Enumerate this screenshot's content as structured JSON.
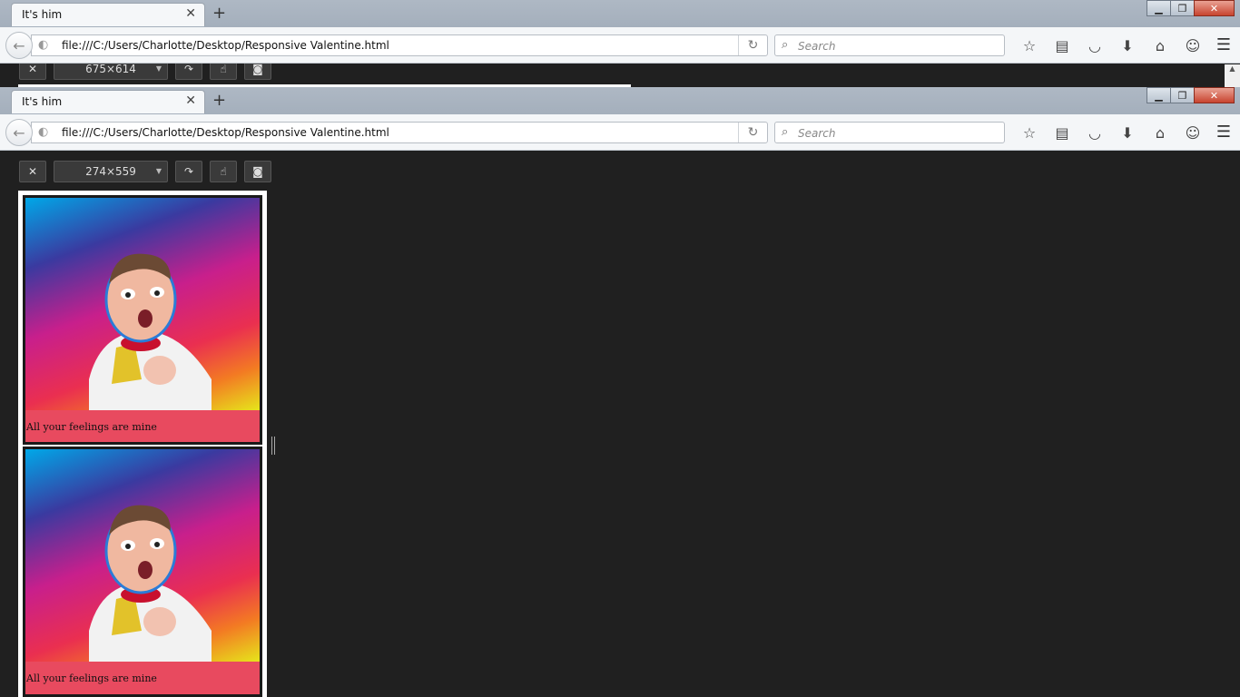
{
  "browser": {
    "tab_title": "It's him",
    "url": "file:///C:/Users/Charlotte/Desktop/Responsive Valentine.html",
    "search_placeholder": "Search",
    "icons": {
      "back": "back-arrow-icon",
      "site_identity": "globe-icon",
      "reload": "reload-icon",
      "search": "magnifier-icon",
      "bookmark": "star-icon",
      "reading_list": "reading-list-icon",
      "pocket": "pocket-icon",
      "downloads": "download-icon",
      "home": "home-icon",
      "hello": "chat-icon",
      "menu": "hamburger-icon"
    }
  },
  "responsive_mode_back": {
    "size": "675×614"
  },
  "responsive_mode": {
    "size": "274×559"
  },
  "page": {
    "cards": [
      {
        "caption": "All your feelings are mine"
      },
      {
        "caption": "All your feelings are mine"
      }
    ]
  }
}
